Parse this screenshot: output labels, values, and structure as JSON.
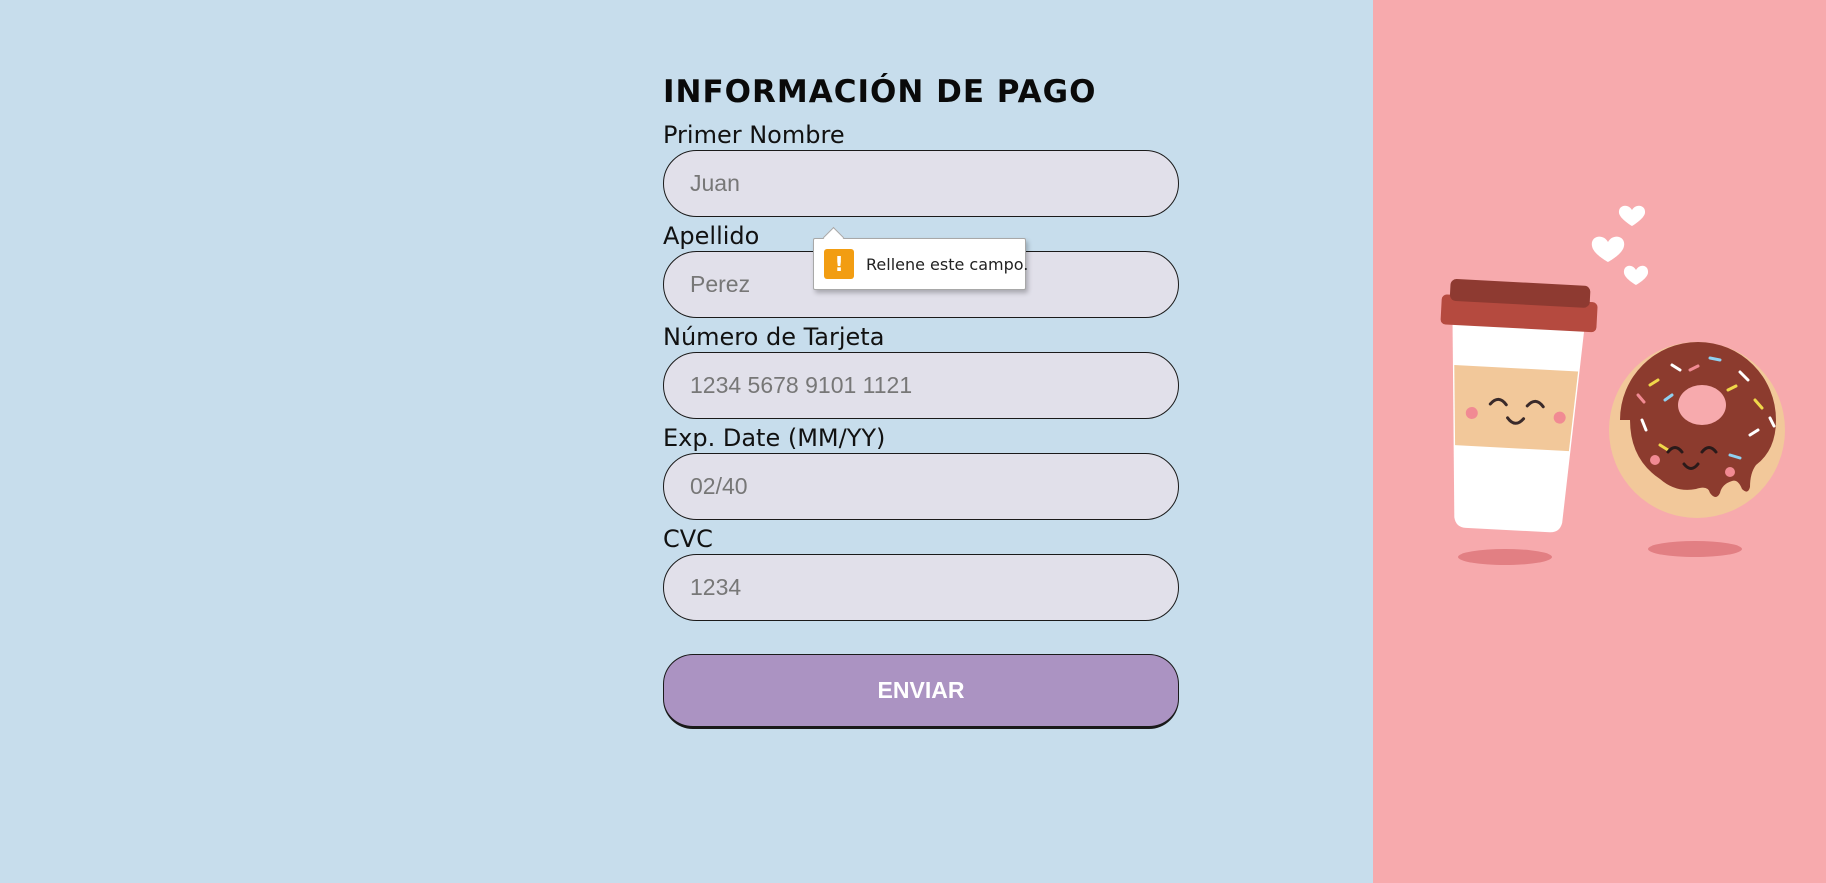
{
  "form": {
    "title": "INFORMACIÓN DE PAGO",
    "fields": [
      {
        "label": "Primer Nombre",
        "placeholder": "Juan",
        "value": ""
      },
      {
        "label": "Apellido",
        "placeholder": "Perez",
        "value": ""
      },
      {
        "label": "Número de Tarjeta",
        "placeholder": "1234 5678 9101 1121",
        "value": ""
      },
      {
        "label": "Exp. Date (MM/YY)",
        "placeholder": "02/40",
        "value": ""
      },
      {
        "label": "CVC",
        "placeholder": "1234",
        "value": ""
      }
    ],
    "submit_label": "ENVIAR"
  },
  "validation_tooltip": {
    "message": "Rellene este campo.",
    "icon": "warning-icon"
  },
  "illustration": {
    "icons": [
      "heart-icon",
      "coffee-cup-icon",
      "donut-icon"
    ]
  },
  "colors": {
    "left_background": "#c7ddec",
    "right_background": "#f7aaad",
    "input_background": "#e1e0ea",
    "button_background": "#ab93c2",
    "warning": "#f29d12"
  }
}
